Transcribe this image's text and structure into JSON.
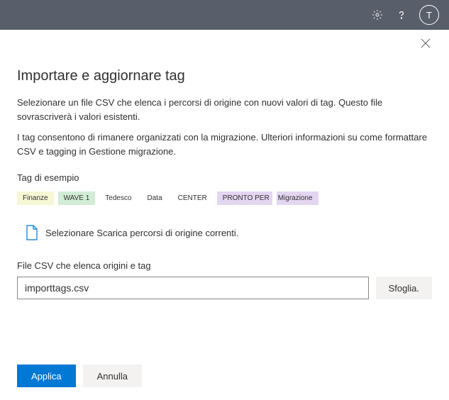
{
  "header": {
    "avatar_initial": "T"
  },
  "panel": {
    "title": "Importare e aggiornare tag",
    "desc1": "Selezionare un file CSV che elenca i percorsi di origine con nuovi valori di tag. Questo file sovrascriverà i valori esistenti.",
    "desc2": "I tag consentono di rimanere organizzati con la migrazione. Ulteriori informazioni su come formattare CSV e tagging in Gestione migrazione.",
    "sample_label": "Tag di esempio",
    "tags": {
      "finance": "Finanze",
      "wave": "WAVE 1",
      "tedesco": "Tedesco",
      "data": "Data",
      "center": "CENTER",
      "pronto": "PRONTO PER",
      "migrazione": "Migrazione"
    },
    "download_text": "Selezionare Scarica percorsi di origine correnti.",
    "field_label": "File CSV che elenca origini e tag",
    "input_value": "importtags.csv",
    "browse_label": "Sfoglia."
  },
  "footer": {
    "apply": "Applica",
    "cancel": "Annulla"
  }
}
